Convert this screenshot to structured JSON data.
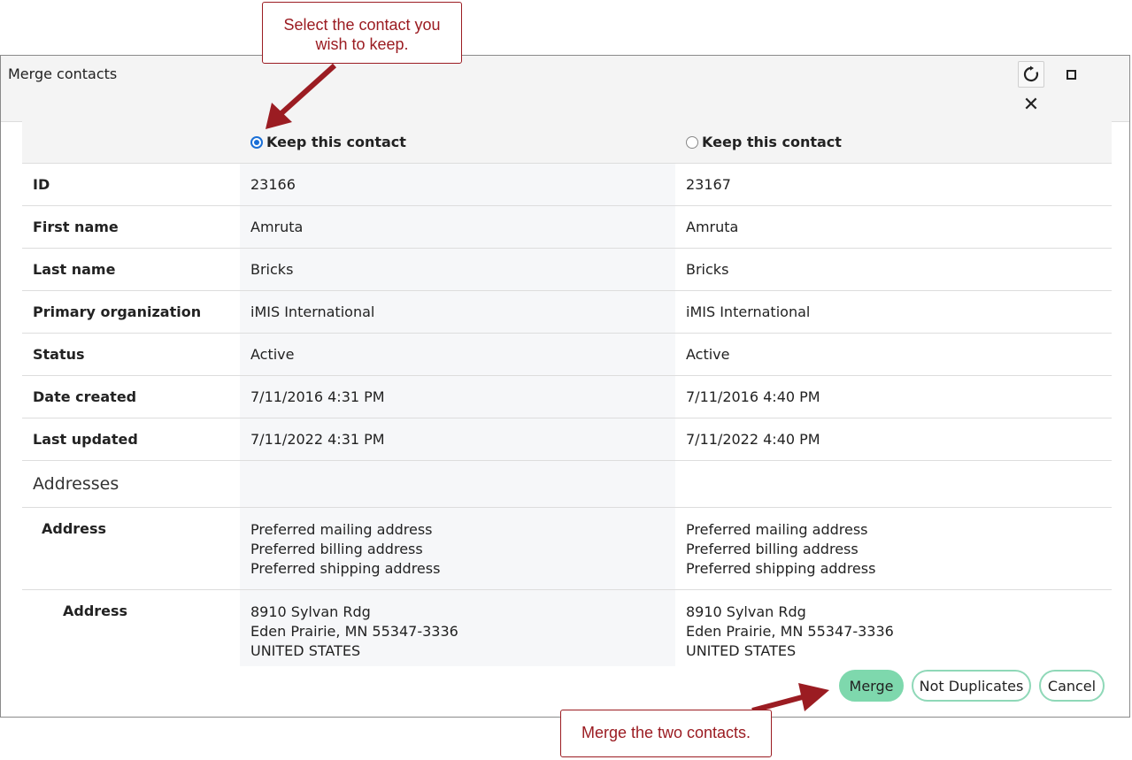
{
  "dialog": {
    "title": "Merge contacts"
  },
  "header_icons": {
    "refresh": "refresh-icon",
    "maximize": "maximize-icon",
    "close": "close-icon",
    "close_glyph": "✕"
  },
  "contacts": {
    "keep_label_a": "Keep this contact",
    "keep_label_b": "Keep this contact",
    "selected": "a"
  },
  "rows": [
    {
      "label": "ID",
      "a": "23166",
      "b": "23167"
    },
    {
      "label": "First name",
      "a": "Amruta",
      "b": "Amruta"
    },
    {
      "label": "Last name",
      "a": "Bricks",
      "b": "Bricks"
    },
    {
      "label": "Primary organization",
      "a": "iMIS International",
      "b": "iMIS International"
    },
    {
      "label": "Status",
      "a": "Active",
      "b": "Active"
    },
    {
      "label": "Date created",
      "a": "7/11/2016 4:31 PM",
      "b": "7/11/2016 4:40 PM"
    },
    {
      "label": "Last updated",
      "a": "7/11/2022 4:31 PM",
      "b": "7/11/2022 4:40 PM"
    }
  ],
  "addresses": {
    "section_title": "Addresses",
    "address_purpose": {
      "label": "Address",
      "a": [
        "Preferred mailing address",
        "Preferred billing address",
        "Preferred shipping address"
      ],
      "b": [
        "Preferred mailing address",
        "Preferred billing address",
        "Preferred shipping address"
      ]
    },
    "address_detail": {
      "label": "Address",
      "a": [
        "8910 Sylvan Rdg",
        "Eden Prairie, MN  55347-3336",
        "UNITED STATES"
      ],
      "b": [
        "8910 Sylvan Rdg",
        "Eden Prairie, MN  55347-3336",
        "UNITED STATES"
      ]
    }
  },
  "buttons": {
    "merge": "Merge",
    "not_duplicates": "Not Duplicates",
    "cancel": "Cancel"
  },
  "callouts": {
    "top_line1": "Select the contact you",
    "top_line2": "wish to keep.",
    "bottom": "Merge the two contacts."
  },
  "colors": {
    "accent_green": "#7ed8ad",
    "callout_red": "#9b1c22",
    "radio_blue": "#1a6fd6"
  }
}
